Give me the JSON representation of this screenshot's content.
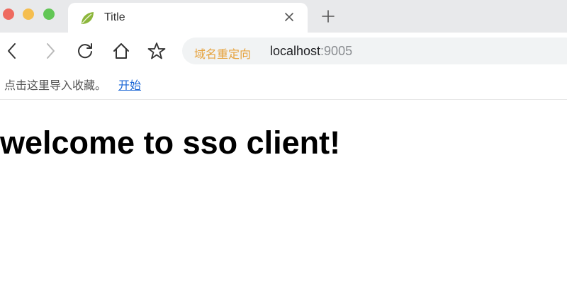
{
  "window": {
    "traffic_lights": {
      "close": "#ee6a5f",
      "minimize": "#f5be4f",
      "zoom": "#62c655"
    }
  },
  "tab": {
    "favicon": "spring-leaf-icon",
    "title": "Title",
    "close_icon": "close-icon",
    "new_tab_icon": "plus-icon"
  },
  "toolbar": {
    "back_icon": "chevron-left-icon",
    "forward_icon": "chevron-right-icon",
    "reload_icon": "reload-icon",
    "home_icon": "home-icon",
    "bookmark_icon": "star-icon"
  },
  "omnibox": {
    "tag": "域名重定向",
    "host": "localhost",
    "port": ":9005",
    "tag_color": "#e6a23c"
  },
  "bookmarks_bar": {
    "hint": "点击这里导入收藏。",
    "link": "开始"
  },
  "page": {
    "heading": "welcome to sso client!"
  }
}
